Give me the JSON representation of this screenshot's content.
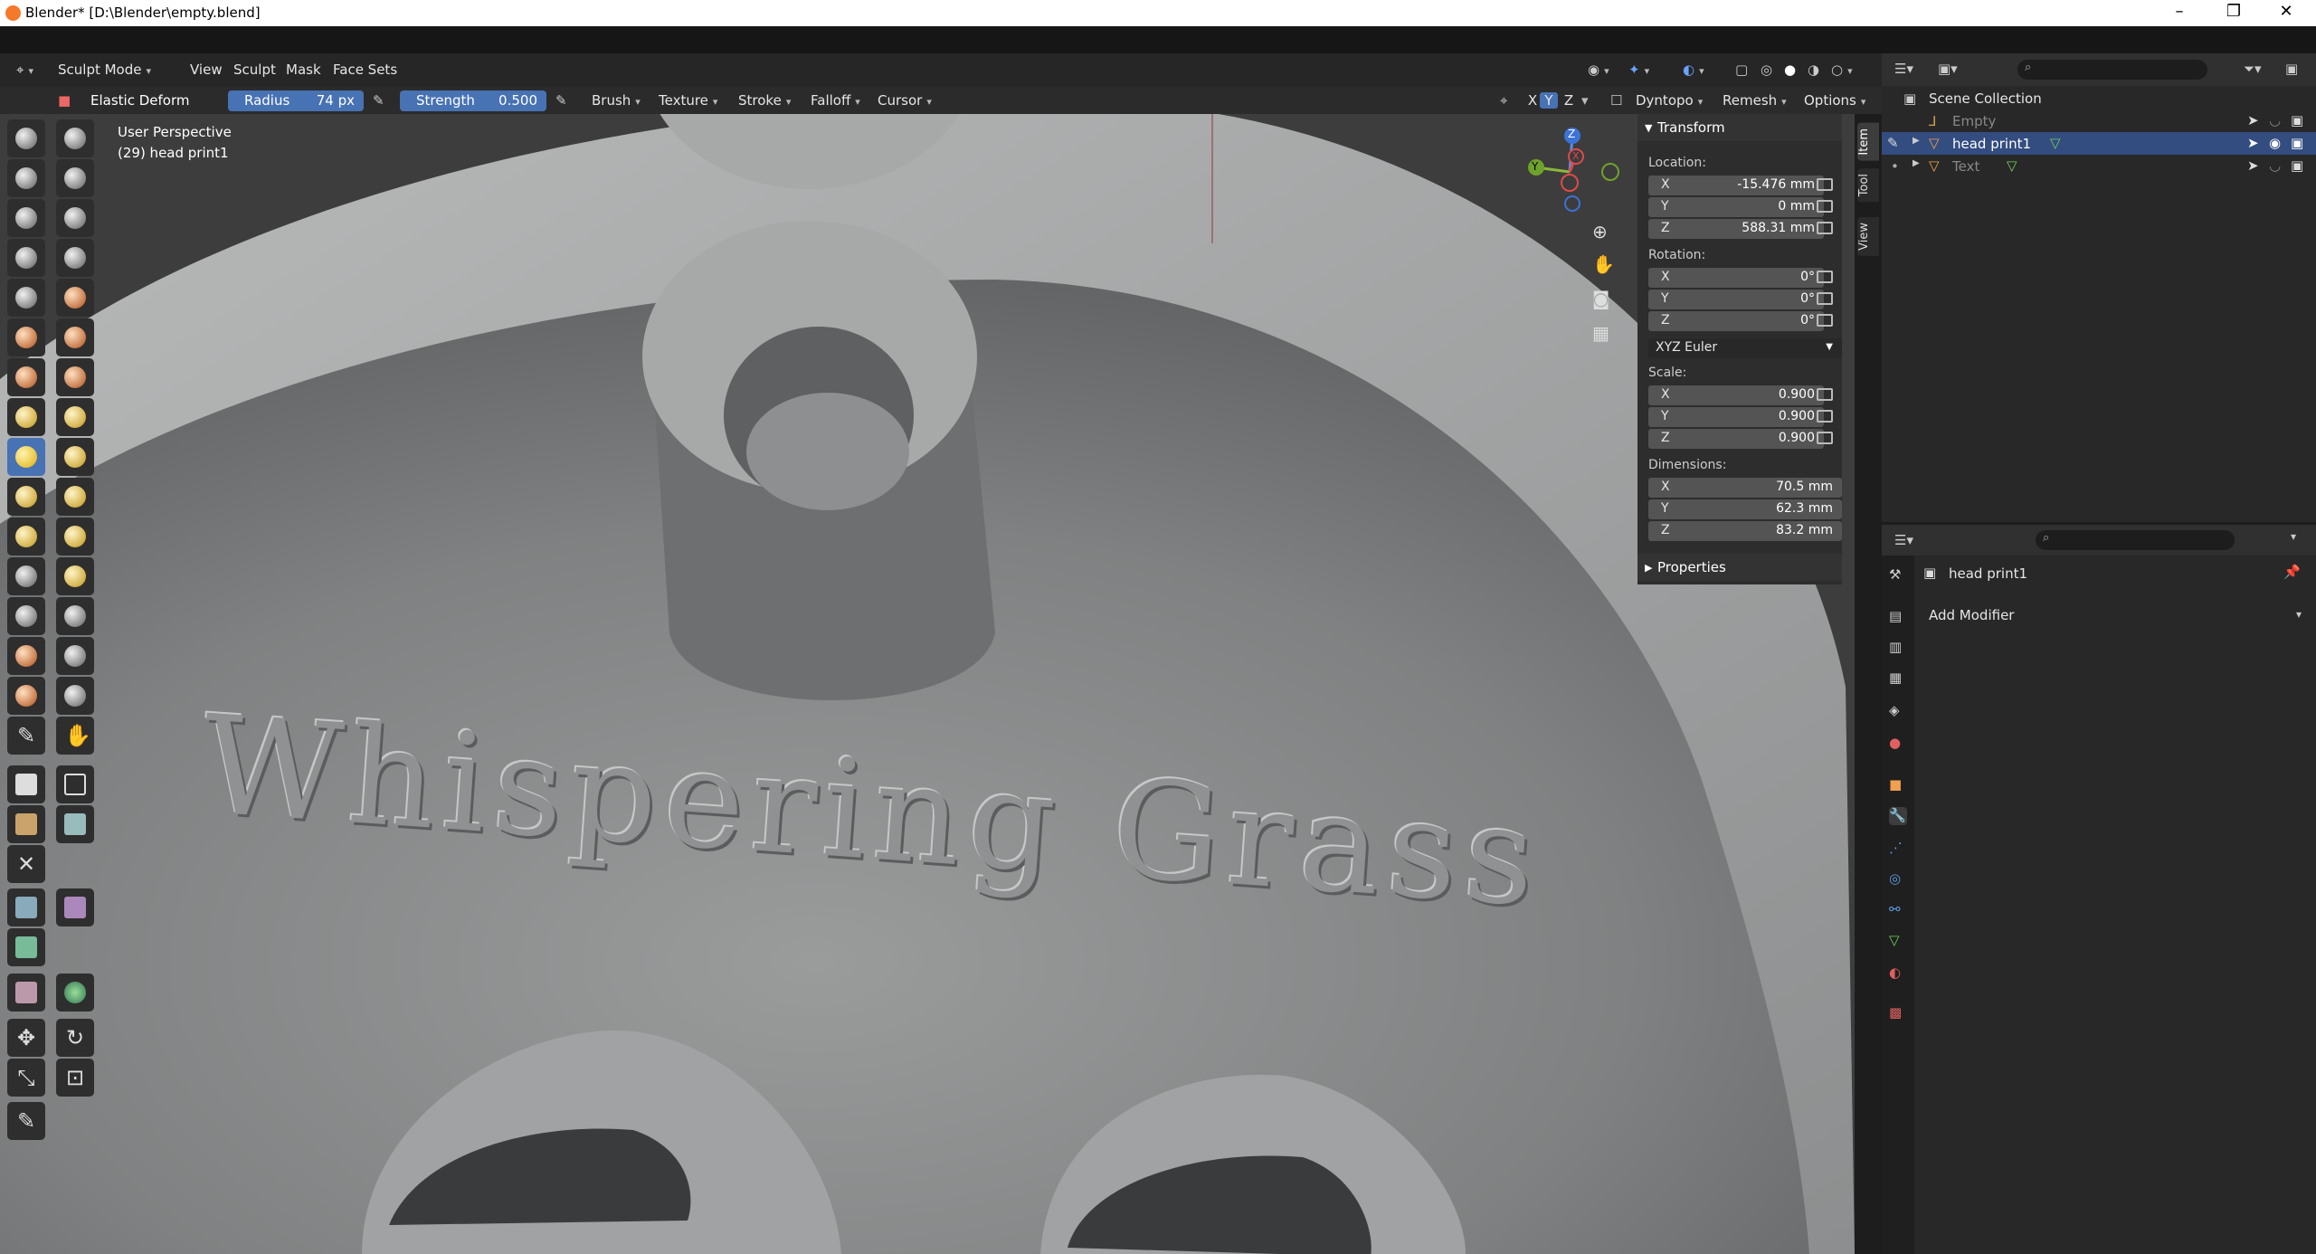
{
  "window": {
    "title": "Blender* [D:\\Blender\\empty.blend]"
  },
  "header": {
    "mode": "Sculpt Mode",
    "menus": [
      "View",
      "Sculpt",
      "Mask",
      "Face Sets"
    ]
  },
  "tool_header": {
    "brush_name": "Elastic Deform",
    "radius_label": "Radius",
    "radius_value": "74 px",
    "strength_label": "Strength",
    "strength_value": "0.500",
    "menus": [
      "Brush",
      "Texture",
      "Stroke",
      "Falloff",
      "Cursor"
    ],
    "axes": [
      "X",
      "Y",
      "Z"
    ],
    "right_menus": [
      "Dyntopo",
      "Remesh",
      "Options"
    ]
  },
  "viewport": {
    "perspective": "User Perspective",
    "object_info": "(29) head print1",
    "model_text": "Whispering Grass",
    "gizmo": {
      "x": "X",
      "y": "Y",
      "z": "Z"
    }
  },
  "npanel": {
    "transform_header": "Transform",
    "location_label": "Location:",
    "location": [
      {
        "axis": "X",
        "value": "-15.476 mm"
      },
      {
        "axis": "Y",
        "value": "0 mm"
      },
      {
        "axis": "Z",
        "value": "588.31 mm"
      }
    ],
    "rotation_label": "Rotation:",
    "rotation": [
      {
        "axis": "X",
        "value": "0°"
      },
      {
        "axis": "Y",
        "value": "0°"
      },
      {
        "axis": "Z",
        "value": "0°"
      }
    ],
    "rotation_mode": "XYZ Euler",
    "scale_label": "Scale:",
    "scale": [
      {
        "axis": "X",
        "value": "0.900"
      },
      {
        "axis": "Y",
        "value": "0.900"
      },
      {
        "axis": "Z",
        "value": "0.900"
      }
    ],
    "dimensions_label": "Dimensions:",
    "dimensions": [
      {
        "axis": "X",
        "value": "70.5 mm"
      },
      {
        "axis": "Y",
        "value": "62.3 mm"
      },
      {
        "axis": "Z",
        "value": "83.2 mm"
      }
    ],
    "properties_header": "Properties",
    "tabs": [
      "Item",
      "Tool",
      "View"
    ]
  },
  "outliner": {
    "root": "Scene Collection",
    "items": [
      {
        "name": "Empty",
        "selected": false
      },
      {
        "name": "head print1",
        "selected": true
      },
      {
        "name": "Text",
        "selected": false
      }
    ]
  },
  "properties": {
    "object_name": "head print1",
    "add_modifier": "Add Modifier"
  },
  "colors": {
    "accent": "#4772b3",
    "selection": "#334d80",
    "background": "#3c3c3c"
  }
}
